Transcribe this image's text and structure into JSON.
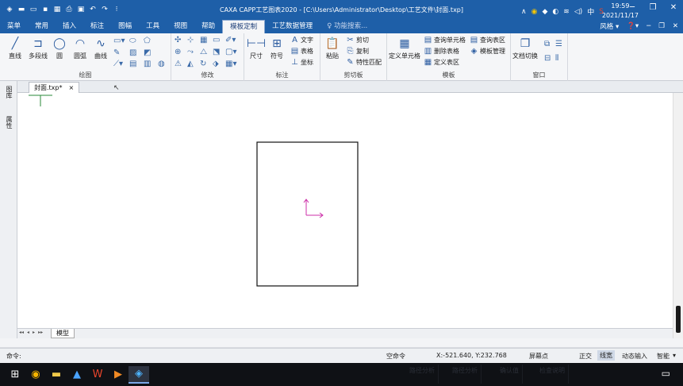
{
  "titlebar": {
    "title": "CAXA CAPP工艺图表2020 - [C:\\Users\\Administrator\\Desktop\\工艺文件\\封面.txp]",
    "quick_icons": [
      "app-icon",
      "new-icon",
      "open-icon",
      "save-icon",
      "save-all-icon",
      "print-icon",
      "print-preview-icon",
      "undo-icon",
      "redo-icon",
      "customize-icon"
    ]
  },
  "menu": {
    "tabs": [
      "菜单",
      "常用",
      "插入",
      "标注",
      "图幅",
      "工具",
      "视图",
      "帮助",
      "模板定制",
      "工艺数据管理"
    ],
    "active_tab": "模板定制",
    "search_placeholder": "功能搜索...",
    "style_label": "风格"
  },
  "ribbon": {
    "draw": {
      "label": "绘图",
      "tools": [
        "直线",
        "多段线",
        "圆",
        "圆弧",
        "曲线"
      ]
    },
    "modify": {
      "label": "修改"
    },
    "annotate": {
      "label": "标注",
      "tools": [
        "尺寸",
        "符号"
      ],
      "small": [
        "文字",
        "表格",
        "坐标"
      ]
    },
    "clipboard": {
      "label": "剪切板",
      "paste": "粘贴",
      "small": [
        "剪切",
        "复制",
        "特性匹配"
      ]
    },
    "template": {
      "label": "模板",
      "define_cell": "定义单元格",
      "small": [
        "查询单元格",
        "删除表格",
        "定义表区",
        "查询表区",
        "模板管理"
      ]
    },
    "window": {
      "label": "窗口",
      "switch": "文档切换"
    }
  },
  "left_panel": {
    "tabs": [
      "图库",
      "属性"
    ]
  },
  "document": {
    "tab_label": "封面.txp*",
    "model_tab": "模型"
  },
  "command": {
    "prompt": "命令:"
  },
  "status": {
    "idle": "空命令",
    "coords": "X:-521.640, Y:232.768",
    "screen_point": "屏幕点",
    "ortho": "正交",
    "line_width": "线宽",
    "dynamic_input": "动态输入",
    "smart": "智能"
  },
  "taskbar": {
    "time": "19:59",
    "date": "2021/11/17",
    "ime": "中",
    "ghost": [
      "路径分析",
      "路径分析",
      "确认值",
      "检查说明"
    ]
  },
  "colors": {
    "accent": "#1e5fa8",
    "frame": "#111111",
    "ucs": "#cc2fa8",
    "crosshair": "#2a8a3a"
  }
}
